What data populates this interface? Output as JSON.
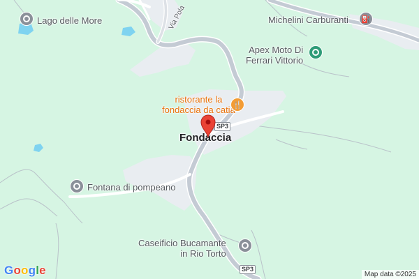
{
  "map": {
    "colors": {
      "land": "#d6f5e3",
      "road": "#c4cbd4",
      "road_casing": "#ffffff",
      "settlement": "#e9edf1",
      "water": "#7fd3f0",
      "contour": "#b9c2c9",
      "pin": "#ea4335"
    },
    "place_label": "Fondaccia",
    "road_labels": {
      "via_pola": "Via Pola"
    },
    "route_shields": [
      "SP3",
      "SP3"
    ],
    "pois": [
      {
        "name": "Lago delle More",
        "icon": "pin-circle-icon",
        "kind": "place"
      },
      {
        "name": "Michelini Carburanti",
        "icon": "gas-station-icon",
        "kind": "service"
      },
      {
        "name_line1": "Apex Moto Di",
        "name_line2": "Ferrari Vittorio",
        "icon": "store-icon",
        "kind": "shop"
      },
      {
        "name_line1": "ristorante la",
        "name_line2": "fondaccia da catia",
        "icon": "restaurant-icon",
        "kind": "food"
      },
      {
        "name": "Fontana di pompeano",
        "icon": "pin-circle-icon",
        "kind": "place"
      },
      {
        "name_line1": "Caseificio Bucamante",
        "name_line2": "in Rio Torto",
        "icon": "pin-circle-icon",
        "kind": "place"
      }
    ],
    "google_logo": [
      "G",
      "o",
      "o",
      "g",
      "l",
      "e"
    ],
    "google_logo_colors": [
      "#4285F4",
      "#EA4335",
      "#FBBC05",
      "#4285F4",
      "#34A853",
      "#EA4335"
    ],
    "attribution": "Map data ©2025"
  }
}
